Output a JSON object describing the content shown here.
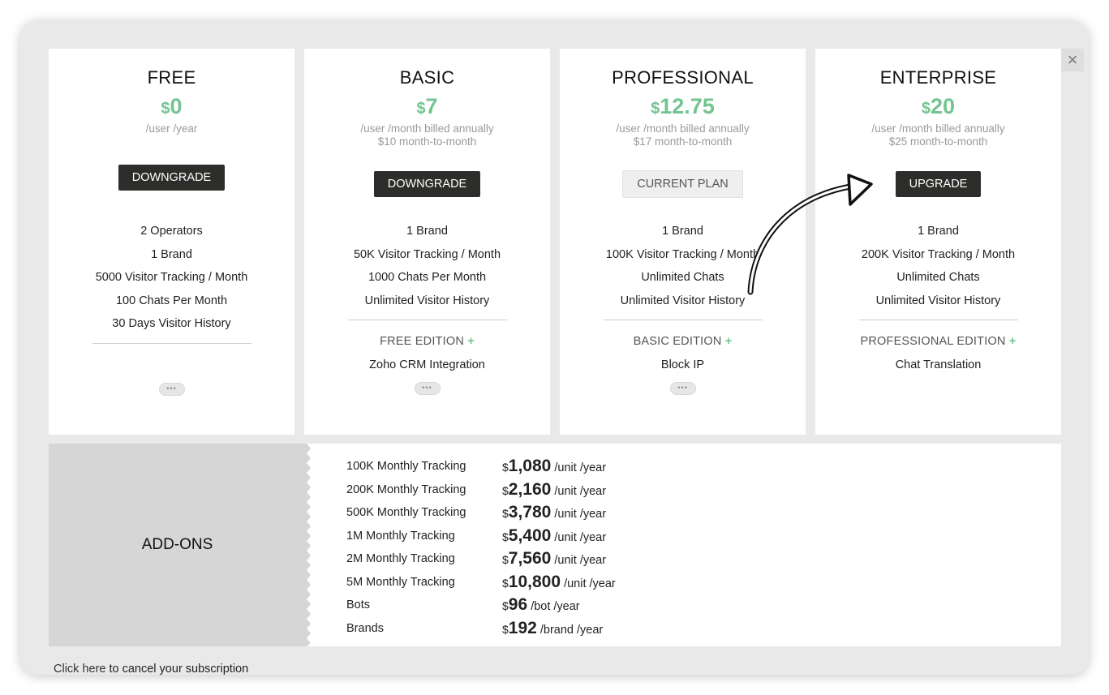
{
  "close_label": "×",
  "plans": [
    {
      "name": "FREE",
      "currency": "$",
      "price": "0",
      "note1": "/user /year",
      "note2": "",
      "button": "DOWNGRADE",
      "button_type": "action",
      "features": [
        "2 Operators",
        "1 Brand",
        "5000 Visitor Tracking / Month",
        "100 Chats Per Month",
        "30 Days Visitor History"
      ],
      "edition": "",
      "edition_feature": "",
      "more": "•••"
    },
    {
      "name": "BASIC",
      "currency": "$",
      "price": "7",
      "note1": "/user /month billed annually",
      "note2": "$10 month-to-month",
      "button": "DOWNGRADE",
      "button_type": "action",
      "features": [
        "1 Brand",
        "50K Visitor Tracking / Month",
        "1000 Chats Per Month",
        "Unlimited Visitor History"
      ],
      "edition": "FREE EDITION",
      "edition_plus": "+",
      "edition_feature": "Zoho CRM Integration",
      "more": "•••"
    },
    {
      "name": "PROFESSIONAL",
      "currency": "$",
      "price": "12.75",
      "note1": "/user /month billed annually",
      "note2": "$17 month-to-month",
      "button": "CURRENT PLAN",
      "button_type": "current",
      "features": [
        "1 Brand",
        "100K Visitor Tracking / Month",
        "Unlimited Chats",
        "Unlimited Visitor History"
      ],
      "edition": "BASIC EDITION",
      "edition_plus": "+",
      "edition_feature": "Block IP",
      "more": "•••"
    },
    {
      "name": "ENTERPRISE",
      "currency": "$",
      "price": "20",
      "note1": "/user /month billed annually",
      "note2": "$25 month-to-month",
      "button": "UPGRADE",
      "button_type": "action",
      "features": [
        "1 Brand",
        "200K Visitor Tracking / Month",
        "Unlimited Chats",
        "Unlimited Visitor History"
      ],
      "edition": "PROFESSIONAL EDITION",
      "edition_plus": "+",
      "edition_feature": "Chat Translation",
      "more": ""
    }
  ],
  "addons": {
    "label": "ADD-ONS",
    "items": [
      {
        "name": "100K Monthly Tracking",
        "currency": "$",
        "amount": "1,080",
        "unit": "/unit /year"
      },
      {
        "name": "200K Monthly Tracking",
        "currency": "$",
        "amount": "2,160",
        "unit": "/unit /year"
      },
      {
        "name": "500K Monthly Tracking",
        "currency": "$",
        "amount": "3,780",
        "unit": "/unit /year"
      },
      {
        "name": "1M Monthly Tracking",
        "currency": "$",
        "amount": "5,400",
        "unit": "/unit /year"
      },
      {
        "name": "2M Monthly Tracking",
        "currency": "$",
        "amount": "7,560",
        "unit": "/unit /year"
      },
      {
        "name": "5M Monthly Tracking",
        "currency": "$",
        "amount": "10,800",
        "unit": "/unit /year"
      },
      {
        "name": "Bots",
        "currency": "$",
        "amount": "96",
        "unit": "/bot /year"
      },
      {
        "name": "Brands",
        "currency": "$",
        "amount": "192",
        "unit": "/brand /year"
      }
    ]
  },
  "footer": {
    "link": "Click here",
    "text": " to cancel your subscription"
  },
  "colors": {
    "price_green": "#73c491",
    "button_dark": "#2d2d2b",
    "panel_bg": "#e9e9e9",
    "addons_label_bg": "#d6d6d6"
  }
}
